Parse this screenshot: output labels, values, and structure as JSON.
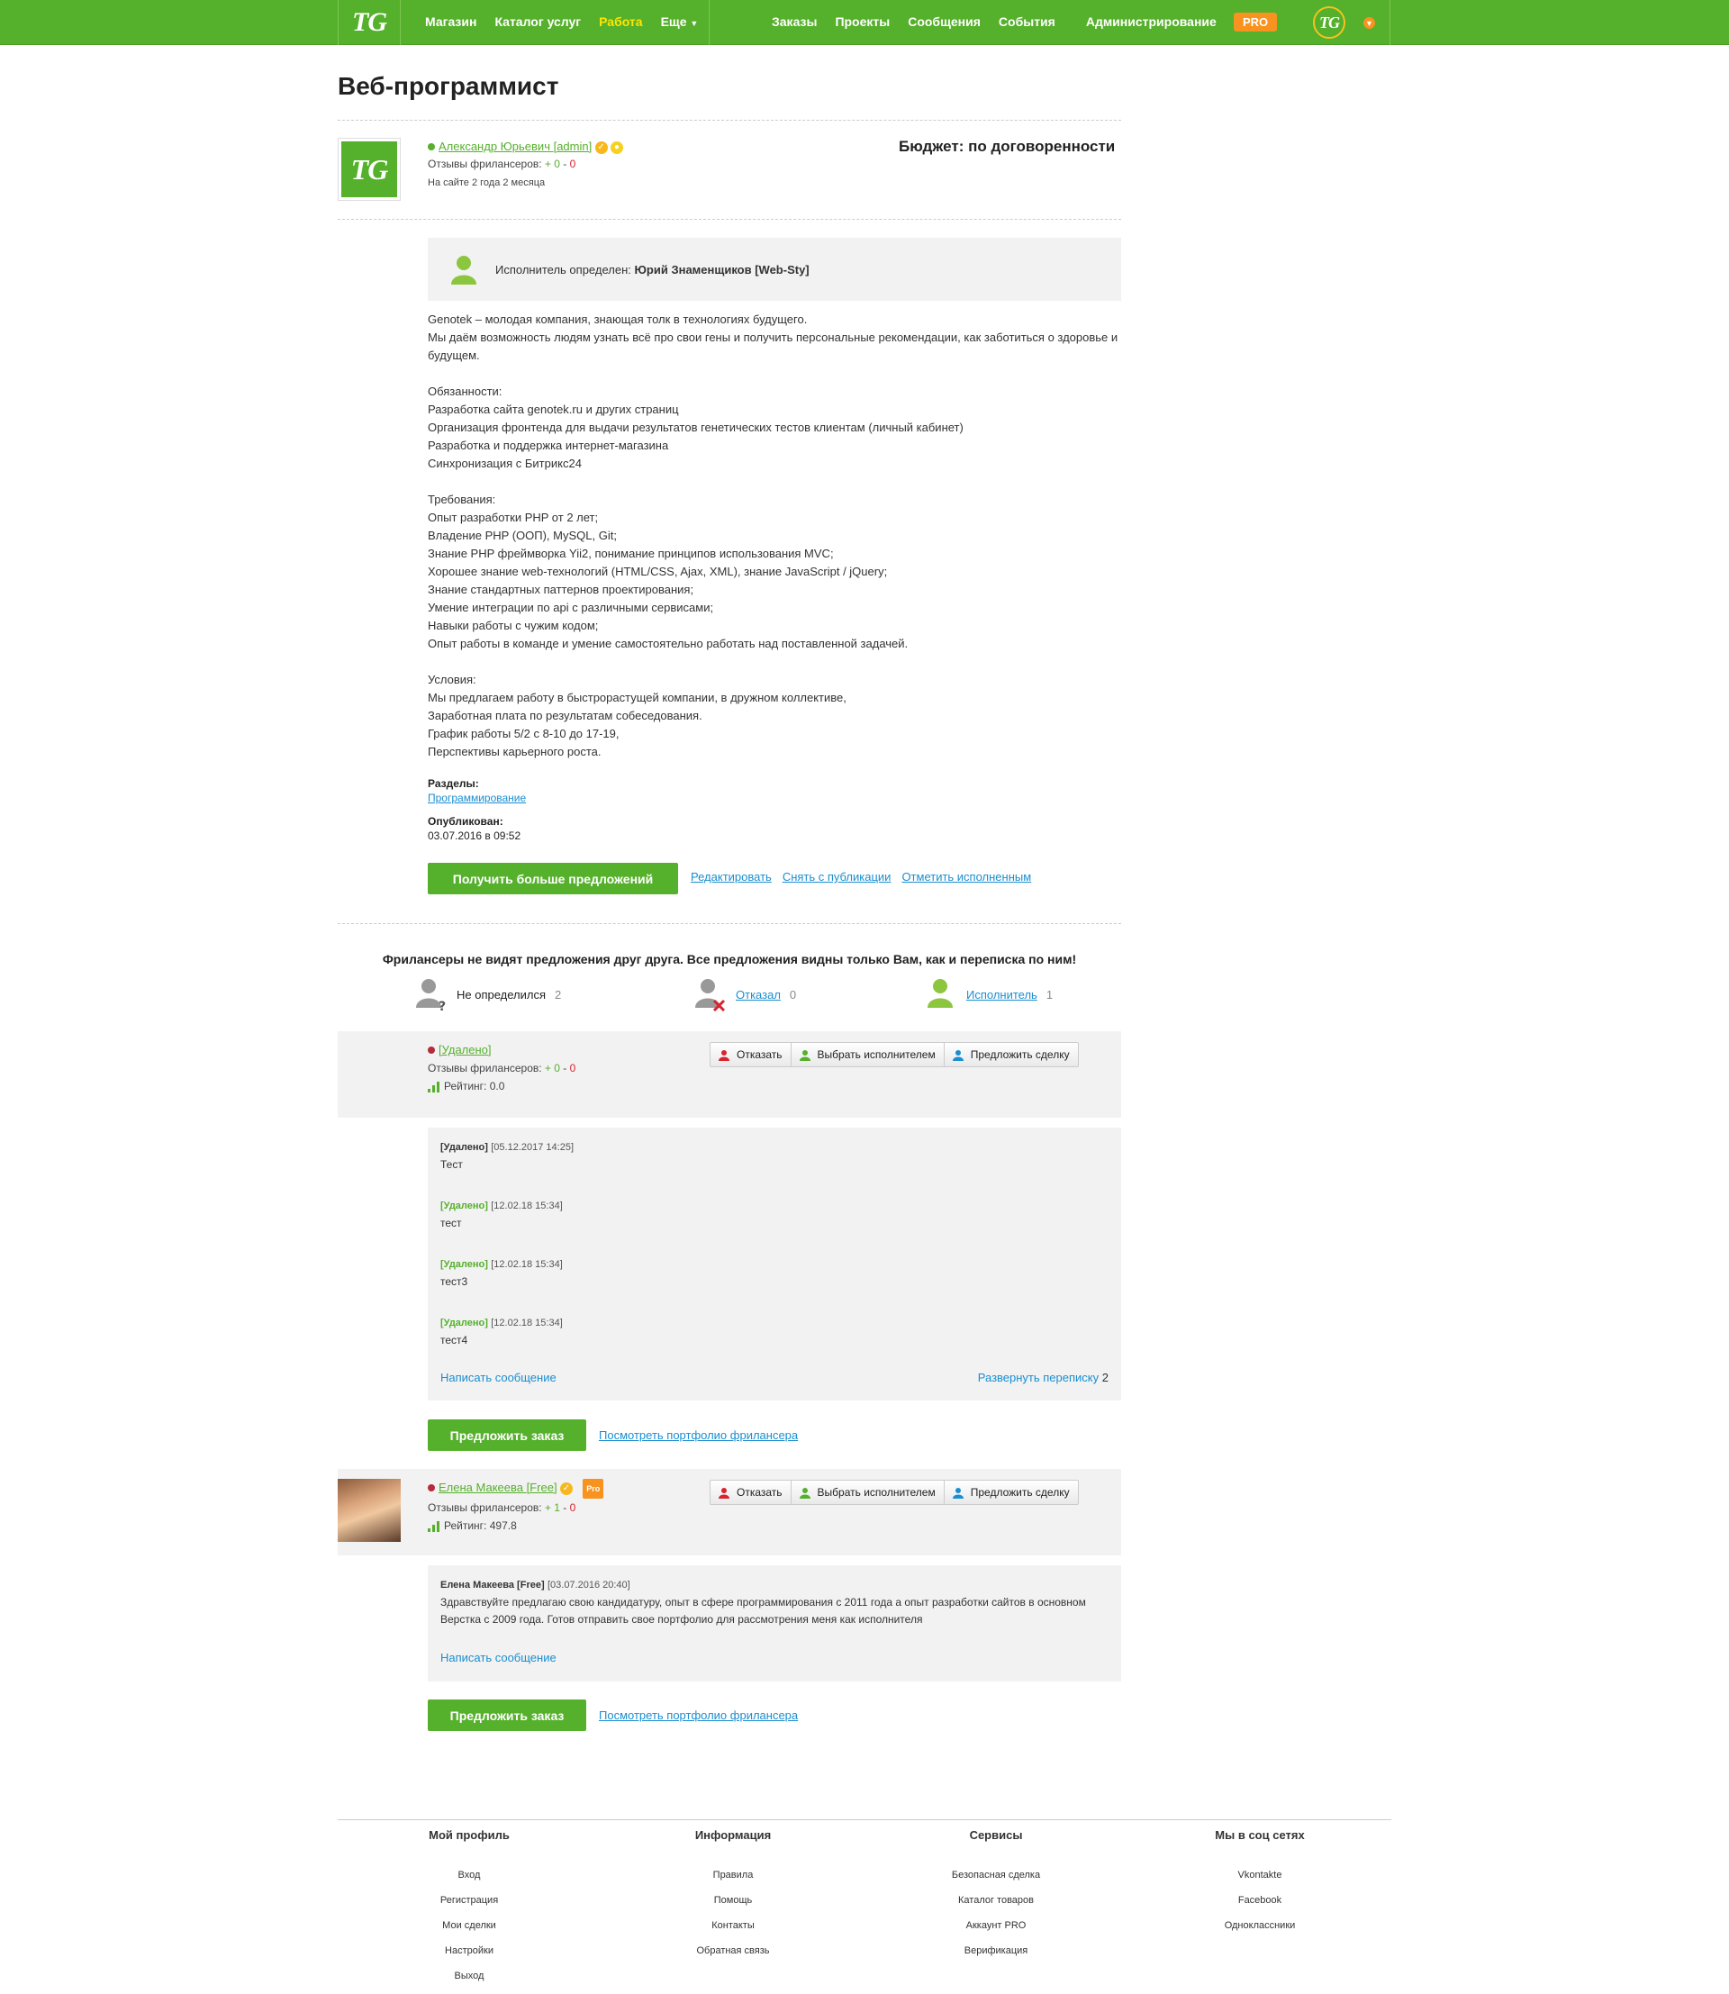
{
  "nav": {
    "logo": "TG",
    "left": [
      "Магазин",
      "Каталог услуг",
      "Работа",
      "Еще"
    ],
    "right": [
      "Заказы",
      "Проекты",
      "Сообщения",
      "События",
      "Администрирование"
    ],
    "pro": "PRO",
    "avatar": "TG"
  },
  "page_title": "Веб-программист",
  "owner": {
    "logo": "TG",
    "name": "Александр Юрьевич",
    "role": "[admin]",
    "reviews_label": "Отзывы фрилансеров:",
    "reviews_plus": "+ 0",
    "reviews_sep": "-",
    "reviews_minus": "0",
    "on_site": "На сайте 2 года 2 месяца"
  },
  "budget": "Бюджет: по договоренности",
  "executor": {
    "label": "Исполнитель определен:",
    "name": "Юрий Знаменщиков [Web-Sty]"
  },
  "description": "Genotek – молодая компания, знающая толк в технологиях будущего.\nМы даём возможность людям узнать всё про свои гены и получить персональные рекомендации, как заботиться о здоровье и будущем.\n\nОбязанности:\nРазработка сайта genotek.ru и других страниц\nОрганизация фронтенда для выдачи результатов генетических тестов клиентам (личный кабинет)\nРазработка и поддержка интернет-магазина\nСинхронизация с Битрикс24\n\nТребования:\nОпыт разработки PHP от 2 лет;\nВладение PHP (ООП), MySQL, Git;\nЗнание PHP фреймворка Yii2, понимание принципов использования MVC;\nХорошее знание web-технологий (HTML/CSS, Ajax, XML), знание JavaScript / jQuery;\nЗнание стандартных паттернов проектирования;\nУмение интеграции по api с различными сервисами;\nНавыки работы с чужим кодом;\nОпыт работы в команде и умение самостоятельно работать над поставленной задачей.\n\nУсловия:\nМы предлагаем работу в быстрорастущей компании, в дружном коллективе,\nЗаработная плата по результатам собеседования.\nГрафик работы 5/2 с 8-10 до 17-19,\nПерспективы карьерного роста.",
  "sections_label": "Разделы:",
  "section_link": "Программирование",
  "published_label": "Опубликован:",
  "published_date": "03.07.2016 в 09:52",
  "actions": {
    "more_offers": "Получить больше предложений",
    "edit": "Редактировать",
    "unpublish": "Снять с публикации",
    "mark_done": "Отметить исполненным"
  },
  "notice": "Фрилансеры не видят предложения друг друга. Все предложения видны только Вам, как и переписка по ним!",
  "stats": {
    "undecided_label": "Не определился",
    "undecided_count": "2",
    "refused_label": "Отказал",
    "refused_count": "0",
    "executor_label": "Исполнитель",
    "executor_count": "1"
  },
  "proposal_buttons": {
    "refuse": "Отказать",
    "choose": "Выбрать исполнителем",
    "deal": "Предложить сделку"
  },
  "proposals": [
    {
      "name": "[Удалено]",
      "reviews_label": "Отзывы фрилансеров:",
      "reviews_plus": "+ 0",
      "reviews_minus": "0",
      "rating": "Рейтинг: 0.0",
      "messages": [
        {
          "author": "[Удалено]",
          "date": "[05.12.2017 14:25]",
          "text": "Тест"
        },
        {
          "author": "[Удалено]",
          "date": "[12.02.18 15:34]",
          "text": "тест"
        },
        {
          "author": "[Удалено]",
          "date": "[12.02.18 15:34]",
          "text": "тест3"
        },
        {
          "author": "[Удалено]",
          "date": "[12.02.18 15:34]",
          "text": "тест4"
        }
      ],
      "write": "Написать сообщение",
      "expand": "Развернуть переписку",
      "expand_count": "2",
      "offer": "Предложить заказ",
      "portfolio": "Посмотреть портфолио фрилансера"
    },
    {
      "name": "Елена Макеева",
      "tag": "[Free]",
      "pro": "Pro",
      "reviews_label": "Отзывы фрилансеров:",
      "reviews_plus": "+ 1",
      "reviews_minus": "0",
      "rating": "Рейтинг: 497.8",
      "messages": [
        {
          "author": "Елена Макеева [Free]",
          "date": "[03.07.2016 20:40]",
          "text": "Здравствуйте предлагаю свою кандидатуру, опыт в сфере программирования с 2011 года а опыт разработки сайтов в основном Верстка с 2009 года. Готов отправить свое портфолио для рассмотрения меня как исполнителя"
        }
      ],
      "write": "Написать сообщение",
      "offer": "Предложить заказ",
      "portfolio": "Посмотреть портфолио фрилансера"
    }
  ],
  "footer": [
    {
      "title": "Мой профиль",
      "links": [
        "Вход",
        "Регистрация",
        "Мои сделки",
        "Настройки",
        "Выход"
      ]
    },
    {
      "title": "Информация",
      "links": [
        "Правила",
        "Помощь",
        "Контакты",
        "Обратная связь"
      ]
    },
    {
      "title": "Сервисы",
      "links": [
        "Безопасная сделка",
        "Каталог товаров",
        "Аккаунт PRO",
        "Верификация"
      ]
    },
    {
      "title": "Мы в соц сетях",
      "links": [
        "Vkontakte",
        "Facebook",
        "Одноклассники"
      ]
    }
  ],
  "colors": {
    "brand_green": "#55b02b",
    "link_blue": "#1a8ed0",
    "pro_orange": "#f7931e",
    "active_nav": "#ffe600"
  }
}
